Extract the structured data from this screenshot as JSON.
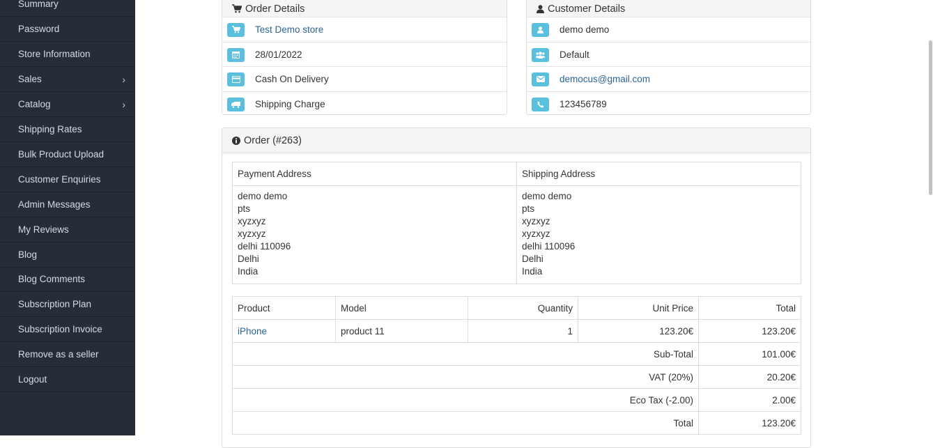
{
  "sidebar": {
    "items": [
      {
        "label": "Summary",
        "has_submenu": false
      },
      {
        "label": "Password",
        "has_submenu": false
      },
      {
        "label": "Store Information",
        "has_submenu": false
      },
      {
        "label": "Sales",
        "has_submenu": true
      },
      {
        "label": "Catalog",
        "has_submenu": true
      },
      {
        "label": "Shipping Rates",
        "has_submenu": false
      },
      {
        "label": "Bulk Product Upload",
        "has_submenu": false
      },
      {
        "label": "Customer Enquiries",
        "has_submenu": false
      },
      {
        "label": "Admin Messages",
        "has_submenu": false
      },
      {
        "label": "My Reviews",
        "has_submenu": false
      },
      {
        "label": "Blog",
        "has_submenu": false
      },
      {
        "label": "Blog Comments",
        "has_submenu": false
      },
      {
        "label": "Subscription Plan",
        "has_submenu": false
      },
      {
        "label": "Subscription Invoice",
        "has_submenu": false
      },
      {
        "label": "Remove as a seller",
        "has_submenu": false
      },
      {
        "label": "Logout",
        "has_submenu": false
      }
    ],
    "chevron": "›"
  },
  "order_details": {
    "title": "Order Details",
    "store": "Test Demo store",
    "date": "28/01/2022",
    "payment_method": "Cash On Delivery",
    "shipping_method": "Shipping Charge"
  },
  "customer_details": {
    "title": "Customer Details",
    "name": "demo demo",
    "group": "Default",
    "email": "democus@gmail.com",
    "phone": "123456789"
  },
  "order": {
    "title": "Order (#263)",
    "payment_address_header": "Payment Address",
    "shipping_address_header": "Shipping Address",
    "payment_address": [
      "demo demo",
      "pts",
      "xyzxyz",
      "xyzxyz",
      "delhi 110096",
      "Delhi",
      "India"
    ],
    "shipping_address": [
      "demo demo",
      "pts",
      "xyzxyz",
      "xyzxyz",
      "delhi 110096",
      "Delhi",
      "India"
    ],
    "product_table": {
      "headers": {
        "product": "Product",
        "model": "Model",
        "quantity": "Quantity",
        "unit_price": "Unit Price",
        "total": "Total"
      },
      "rows": [
        {
          "product": "iPhone",
          "model": "product 11",
          "quantity": "1",
          "unit_price": "123.20€",
          "total": "123.20€"
        }
      ],
      "totals": [
        {
          "label": "Sub-Total",
          "value": "101.00€"
        },
        {
          "label": "VAT (20%)",
          "value": "20.20€"
        },
        {
          "label": "Eco Tax (-2.00)",
          "value": "2.00€"
        },
        {
          "label": "Total",
          "value": "123.20€"
        }
      ]
    }
  },
  "icons": {
    "order_details_header": "shopping-cart-icon",
    "customer_details_header": "user-icon",
    "order_header": "info-circle-icon",
    "store": "cart-icon",
    "date": "calendar-icon",
    "payment": "credit-card-icon",
    "shipping": "truck-icon",
    "customer": "user-icon",
    "group": "users-icon",
    "email": "envelope-icon",
    "phone": "phone-icon"
  },
  "colors": {
    "sidebar_bg": "#252d38",
    "badge": "#5bc0de",
    "link": "#2a6496"
  }
}
